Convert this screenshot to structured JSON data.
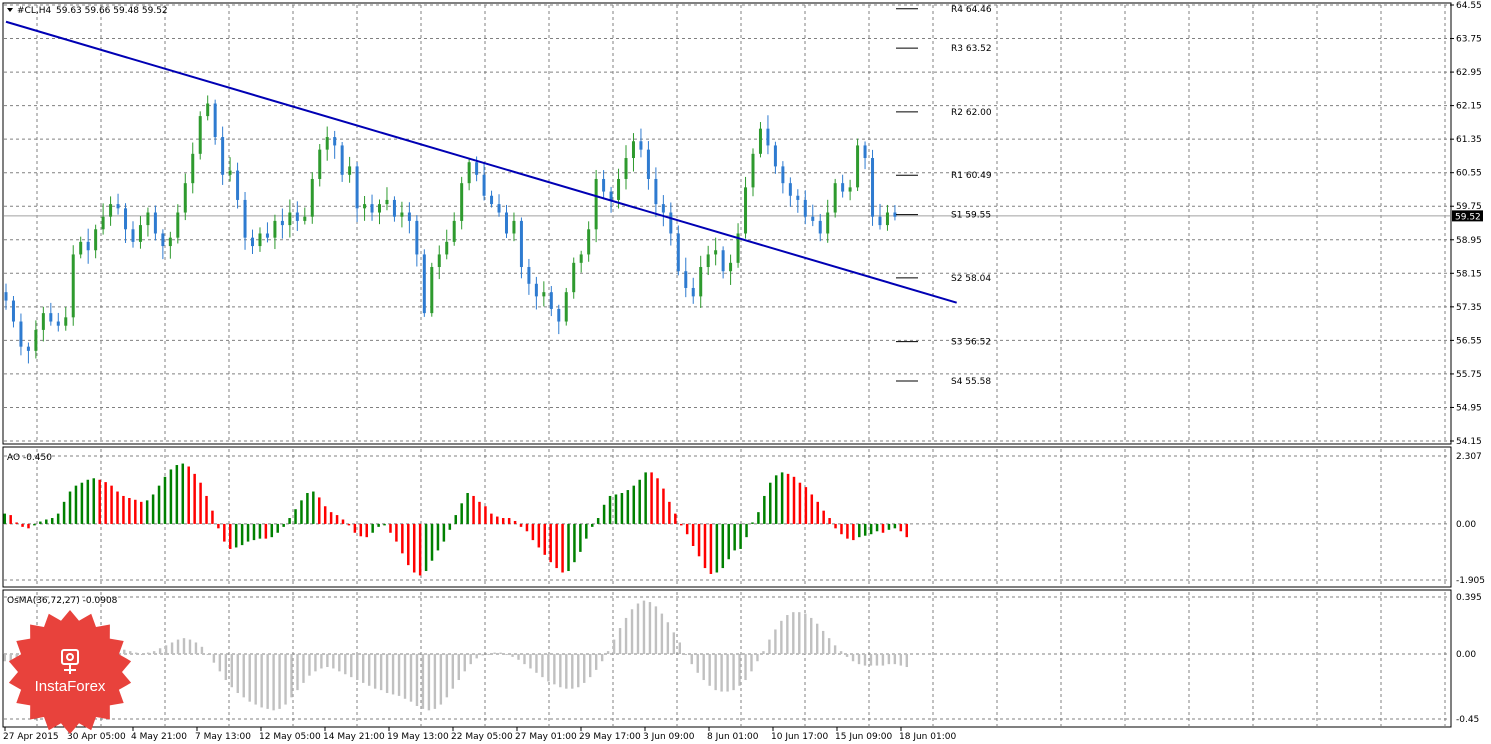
{
  "header": {
    "symbol": "#CL,H4",
    "ohlc": "59.63 59.66 59.48 59.52",
    "current_price": "59.52"
  },
  "ao_panel": {
    "title": "AO -0.450"
  },
  "osma_panel": {
    "title": "OsMA(36,72,27) -0.0908"
  },
  "watermark": {
    "brand": "InstaForex"
  },
  "colors": {
    "bull": "#2e9a2e",
    "bear": "#2e7bd0",
    "ao_up": "#008000",
    "ao_down": "#ff0000",
    "osma": "#c0c0c0",
    "trendline": "#0000b4",
    "grid": "#808080",
    "logo": "#e8423c"
  },
  "chart_data": [
    {
      "type": "candlestick",
      "ylim": [
        54.15,
        64.55
      ],
      "yticks": [
        "64.55",
        "63.75",
        "62.95",
        "62.15",
        "61.35",
        "60.55",
        "59.75",
        "58.95",
        "58.15",
        "57.35",
        "56.55",
        "55.75",
        "54.95",
        "54.15"
      ],
      "xticks": [
        "27 Apr 2015",
        "30 Apr 05:00",
        "4 May 21:00",
        "7 May 13:00",
        "12 May 05:00",
        "14 May 21:00",
        "19 May 13:00",
        "22 May 05:00",
        "27 May 01:00",
        "29 May 17:00",
        "3 Jun 09:00",
        "8 Jun 01:00",
        "10 Jun 17:00",
        "15 Jun 09:00",
        "18 Jun 01:00"
      ],
      "close_series": [
        57.5,
        57.0,
        56.4,
        56.3,
        56.8,
        57.2,
        57.0,
        56.9,
        57.1,
        58.6,
        58.9,
        58.7,
        59.2,
        59.5,
        59.8,
        59.7,
        59.2,
        58.9,
        59.3,
        59.6,
        59.1,
        58.8,
        59.0,
        59.6,
        60.3,
        61.0,
        61.9,
        62.2,
        61.4,
        60.5,
        60.6,
        59.9,
        59.0,
        58.8,
        59.1,
        59.0,
        59.4,
        59.3,
        59.6,
        59.4,
        59.5,
        60.4,
        61.1,
        61.4,
        61.2,
        60.5,
        60.7,
        59.7,
        59.8,
        59.6,
        59.8,
        59.9,
        59.5,
        59.6,
        59.4,
        58.6,
        57.2,
        58.3,
        58.6,
        58.9,
        59.4,
        60.3,
        60.8,
        60.5,
        60.0,
        59.8,
        59.6,
        59.1,
        59.4,
        58.3,
        57.9,
        57.6,
        57.7,
        57.3,
        57.0,
        57.7,
        58.4,
        58.6,
        59.2,
        60.4,
        60.1,
        59.9,
        60.4,
        60.9,
        61.3,
        61.1,
        60.4,
        59.8,
        59.6,
        59.1,
        58.2,
        57.8,
        57.6,
        58.3,
        58.6,
        58.7,
        58.2,
        58.4,
        59.1,
        60.2,
        61.0,
        61.6,
        61.2,
        60.7,
        60.3,
        60.0,
        59.9,
        59.5,
        59.4,
        59.1,
        59.6,
        60.3,
        60.1,
        60.2,
        61.2,
        60.9,
        59.5,
        59.3,
        59.6,
        59.5
      ],
      "ohlc_values": {
        "open": 59.63,
        "high": 59.66,
        "low": 59.48,
        "close": 59.52
      },
      "pivot_levels": [
        {
          "name": "R4",
          "value": 64.46
        },
        {
          "name": "R3",
          "value": 63.52
        },
        {
          "name": "R2",
          "value": 62.0
        },
        {
          "name": "R1",
          "value": 60.49
        },
        {
          "name": "S1",
          "value": 59.55
        },
        {
          "name": "S2",
          "value": 58.04
        },
        {
          "name": "S3",
          "value": 56.52
        },
        {
          "name": "S4",
          "value": 55.58
        }
      ],
      "trendline": {
        "from": {
          "bar": 0,
          "price": 64.15
        },
        "to": {
          "bar": 127,
          "price": 57.45
        }
      }
    },
    {
      "type": "bar",
      "name": "AO",
      "ylim": [
        -1.905,
        2.307
      ],
      "yticks": [
        "2.307",
        "0.00",
        "-1.905"
      ],
      "values": [
        0.35,
        0.3,
        0.05,
        -0.1,
        -0.15,
        -0.05,
        0.08,
        0.15,
        0.2,
        0.35,
        0.75,
        1.1,
        1.3,
        1.4,
        1.5,
        1.55,
        1.5,
        1.42,
        1.3,
        1.1,
        0.95,
        0.88,
        0.82,
        0.75,
        0.8,
        1.0,
        1.3,
        1.6,
        1.85,
        2.0,
        2.05,
        1.95,
        1.7,
        1.4,
        0.95,
        0.45,
        -0.15,
        -0.6,
        -0.85,
        -0.8,
        -0.72,
        -0.6,
        -0.55,
        -0.5,
        -0.5,
        -0.45,
        -0.3,
        -0.1,
        0.2,
        0.5,
        0.8,
        1.05,
        1.1,
        0.9,
        0.6,
        0.4,
        0.3,
        0.15,
        -0.05,
        -0.3,
        -0.42,
        -0.45,
        -0.3,
        -0.1,
        -0.05,
        -0.3,
        -0.6,
        -1.0,
        -1.4,
        -1.65,
        -1.75,
        -1.6,
        -1.25,
        -0.9,
        -0.6,
        -0.2,
        0.3,
        0.7,
        1.05,
        0.95,
        0.75,
        0.6,
        0.35,
        0.25,
        0.2,
        0.2,
        0.1,
        -0.1,
        -0.25,
        -0.55,
        -0.8,
        -1.05,
        -1.3,
        -1.5,
        -1.65,
        -1.6,
        -1.3,
        -0.95,
        -0.5,
        -0.1,
        0.2,
        0.65,
        0.95,
        1.0,
        1.05,
        1.15,
        1.3,
        1.5,
        1.75,
        1.75,
        1.55,
        1.2,
        0.75,
        0.35,
        -0.05,
        -0.35,
        -0.75,
        -1.1,
        -1.5,
        -1.7,
        -1.65,
        -1.5,
        -1.2,
        -0.9,
        -0.85,
        -0.45,
        0.05,
        0.4,
        0.95,
        1.4,
        1.65,
        1.75,
        1.7,
        1.6,
        1.4,
        1.25,
        1.0,
        0.75,
        0.45,
        0.2,
        -0.15,
        -0.35,
        -0.5,
        -0.55,
        -0.45,
        -0.4,
        -0.35,
        -0.25,
        -0.3,
        -0.2,
        -0.15,
        -0.25,
        -0.45
      ]
    },
    {
      "type": "bar",
      "name": "OsMA",
      "ylim": [
        -0.45,
        0.395
      ],
      "yticks": [
        "0.395",
        "0.00",
        "-0.45"
      ],
      "values": [
        -0.05,
        -0.06,
        -0.06,
        -0.05,
        -0.04,
        -0.03,
        -0.02,
        0.0,
        0.02,
        0.04,
        0.06,
        0.08,
        0.09,
        0.1,
        0.1,
        0.09,
        0.08,
        0.07,
        0.05,
        0.04,
        0.03,
        0.02,
        0.01,
        0.0,
        0.01,
        0.02,
        0.04,
        0.06,
        0.08,
        0.1,
        0.11,
        0.1,
        0.08,
        0.05,
        0.0,
        -0.06,
        -0.12,
        -0.18,
        -0.23,
        -0.27,
        -0.3,
        -0.33,
        -0.35,
        -0.37,
        -0.38,
        -0.39,
        -0.38,
        -0.35,
        -0.3,
        -0.25,
        -0.2,
        -0.15,
        -0.12,
        -0.1,
        -0.09,
        -0.1,
        -0.12,
        -0.14,
        -0.16,
        -0.18,
        -0.2,
        -0.22,
        -0.24,
        -0.25,
        -0.27,
        -0.28,
        -0.29,
        -0.31,
        -0.33,
        -0.36,
        -0.38,
        -0.39,
        -0.38,
        -0.35,
        -0.3,
        -0.24,
        -0.18,
        -0.12,
        -0.07,
        -0.03,
        -0.01,
        0.0,
        0.01,
        0.01,
        0.0,
        -0.02,
        -0.04,
        -0.07,
        -0.1,
        -0.13,
        -0.16,
        -0.19,
        -0.21,
        -0.23,
        -0.24,
        -0.24,
        -0.23,
        -0.2,
        -0.16,
        -0.11,
        -0.05,
        0.02,
        0.1,
        0.18,
        0.25,
        0.31,
        0.35,
        0.37,
        0.36,
        0.33,
        0.28,
        0.22,
        0.15,
        0.08,
        0.0,
        -0.07,
        -0.13,
        -0.18,
        -0.22,
        -0.25,
        -0.26,
        -0.26,
        -0.25,
        -0.22,
        -0.18,
        -0.12,
        -0.05,
        0.02,
        0.1,
        0.17,
        0.23,
        0.27,
        0.29,
        0.29,
        0.28,
        0.25,
        0.21,
        0.16,
        0.11,
        0.06,
        0.02,
        -0.02,
        -0.05,
        -0.07,
        -0.08,
        -0.08,
        -0.08,
        -0.08,
        -0.07,
        -0.07,
        -0.08,
        -0.09
      ]
    }
  ]
}
